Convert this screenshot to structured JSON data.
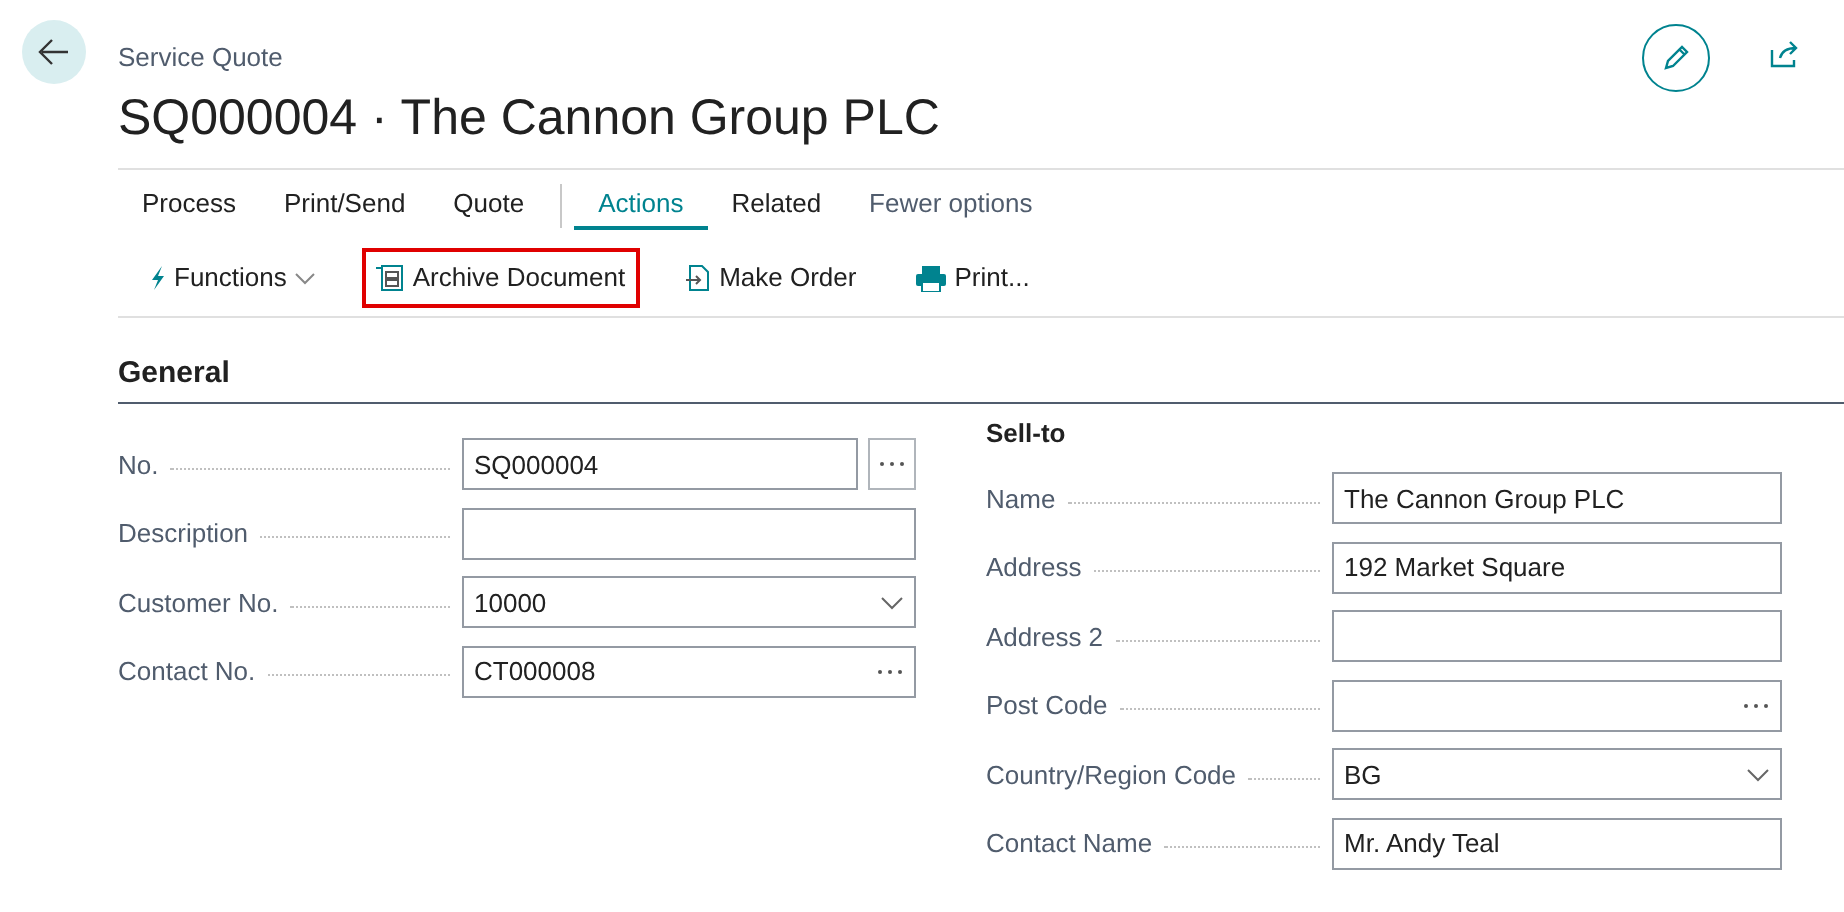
{
  "header": {
    "caption": "Service Quote",
    "title": "SQ000004 · The Cannon Group PLC"
  },
  "tabs": [
    {
      "label": "Process",
      "selected": false
    },
    {
      "label": "Print/Send",
      "selected": false
    },
    {
      "label": "Quote",
      "selected": false
    },
    {
      "label": "Actions",
      "selected": true
    },
    {
      "label": "Related",
      "selected": false
    },
    {
      "label": "Fewer options",
      "kind": "toggle"
    }
  ],
  "actions": [
    {
      "label": "Functions",
      "kind": "menu",
      "highlighted": false
    },
    {
      "label": "Archive Document",
      "kind": "archive",
      "highlighted": true
    },
    {
      "label": "Make Order",
      "kind": "order",
      "highlighted": false
    },
    {
      "label": "Print...",
      "kind": "print",
      "highlighted": false
    }
  ],
  "section": {
    "title": "General"
  },
  "left_fields": [
    {
      "label": "No.",
      "value": "SQ000004",
      "kind": "assist"
    },
    {
      "label": "Description",
      "kind": "plain"
    },
    {
      "label": "Customer No.",
      "value": "10000",
      "kind": "dropdown"
    },
    {
      "label": "Contact No.",
      "value": "CT000008",
      "kind": "inline-assist"
    }
  ],
  "right_group": {
    "title": "Sell-to",
    "fields": [
      {
        "label": "Name",
        "value": "The Cannon Group PLC",
        "kind": "plain"
      },
      {
        "label": "Address",
        "value": "192 Market Square",
        "kind": "plain"
      },
      {
        "label": "Address 2",
        "kind": "plain"
      },
      {
        "label": "Post Code",
        "kind": "inline-assist"
      },
      {
        "label": "Country/Region Code",
        "value": "BG",
        "kind": "dropdown"
      },
      {
        "label": "Contact Name",
        "value": "Mr. Andy Teal",
        "kind": "plain"
      }
    ]
  }
}
